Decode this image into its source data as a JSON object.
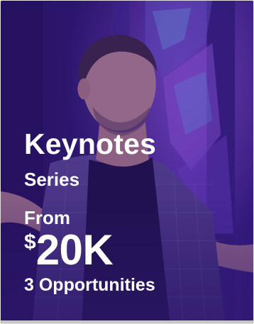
{
  "card": {
    "title": "Keynotes",
    "subtitle": "Series",
    "price_prefix": "From",
    "currency": "$",
    "price": "20K",
    "opportunities": "3 Opportunities"
  },
  "colors": {
    "overlay": "#3a1d8a",
    "text": "#ffffff",
    "stage_light": "#8a4bd8"
  }
}
